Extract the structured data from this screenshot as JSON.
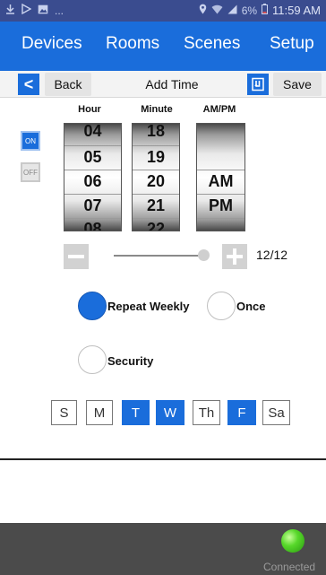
{
  "status_bar": {
    "time": "11:59 AM",
    "battery": "6%",
    "overflow": "...",
    "icons": [
      "download-icon",
      "play-store-icon",
      "image-icon",
      "location-icon",
      "wifi-icon",
      "signal-icon",
      "battery-icon"
    ]
  },
  "nav": {
    "tabs": [
      {
        "label": "Devices"
      },
      {
        "label": "Rooms"
      },
      {
        "label": "Scenes"
      },
      {
        "label": "Setup"
      }
    ]
  },
  "toolbar": {
    "back_icon": "<",
    "back_label": "Back",
    "title": "Add Time",
    "save_label": "Save"
  },
  "columns": {
    "hour": "Hour",
    "minute": "Minute",
    "ampm": "AM/PM"
  },
  "toggle": {
    "on_label": "ON",
    "off_label": "OFF"
  },
  "pickers": {
    "hour": [
      "04",
      "05",
      "06",
      "07",
      "08"
    ],
    "minute": [
      "18",
      "19",
      "20",
      "21",
      "22"
    ],
    "ampm": [
      "",
      "",
      "AM",
      "PM",
      ""
    ]
  },
  "slider": {
    "value_text": "12/12",
    "level": 1.0
  },
  "schedule": {
    "repeat_weekly": {
      "label": "Repeat Weekly",
      "selected": true
    },
    "once": {
      "label": "Once",
      "selected": false
    },
    "security": {
      "label": "Security",
      "selected": false
    }
  },
  "days": [
    {
      "label": "S",
      "selected": false
    },
    {
      "label": "M",
      "selected": false
    },
    {
      "label": "T",
      "selected": true
    },
    {
      "label": "W",
      "selected": true
    },
    {
      "label": "Th",
      "selected": false
    },
    {
      "label": "F",
      "selected": true
    },
    {
      "label": "Sa",
      "selected": false
    }
  ],
  "footer": {
    "status": "Connected"
  },
  "colors": {
    "accent": "#1a6ddb",
    "status_bar": "#3a4c8f",
    "footer": "#4b4b4b",
    "connected": "#57d82a"
  }
}
